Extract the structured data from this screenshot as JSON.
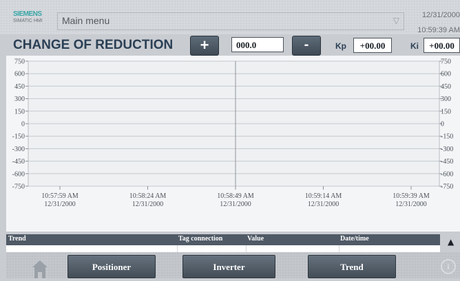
{
  "header": {
    "logo": "SIEMENS",
    "logo_sub": "SIMATIC HMI",
    "menu_label": "Main menu",
    "date": "12/31/2000",
    "time": "10:59:39 AM"
  },
  "controls": {
    "title": "CHANGE OF REDUCTION",
    "plus_label": "+",
    "minus_label": "-",
    "value": "000.0",
    "kp_label": "Kp",
    "kp_value": "+00.00",
    "ki_label": "Ki",
    "ki_value": "+00.00"
  },
  "chart_data": {
    "type": "line",
    "y_ticks": [
      "750",
      "600",
      "450",
      "300",
      "150",
      "0",
      "-150",
      "-300",
      "-450",
      "-600",
      "-750"
    ],
    "y_ticks_right": [
      "750",
      "600",
      "450",
      "300",
      "150",
      "0",
      "-150",
      "-300",
      "-450",
      "-600",
      "-750"
    ],
    "ylim": [
      -750,
      750
    ],
    "grid": true,
    "x_ticks": [
      {
        "time": "10:57:59 AM",
        "date": "12/31/2000"
      },
      {
        "time": "10:58:24 AM",
        "date": "12/31/2000"
      },
      {
        "time": "10:58:49 AM",
        "date": "12/31/2000"
      },
      {
        "time": "10:59:14 AM",
        "date": "12/31/2000"
      },
      {
        "time": "10:59:39 AM",
        "date": "12/31/2000"
      }
    ],
    "series": []
  },
  "table": {
    "columns": [
      "Trend",
      "Tag connection",
      "Value",
      "Date/time"
    ],
    "rows": [
      [
        "",
        "",
        "",
        ""
      ],
      [
        "",
        "",
        "",
        ""
      ]
    ]
  },
  "scroll": {
    "up": "▲",
    "down": "▼"
  },
  "nav": {
    "positioner": "Positioner",
    "inverter": "Inverter",
    "trend": "Trend",
    "info": "i"
  },
  "colors": {
    "header_text": "#2b4055",
    "button_dark": "#4f5a66",
    "trend_bg": "#f4f5f7"
  }
}
